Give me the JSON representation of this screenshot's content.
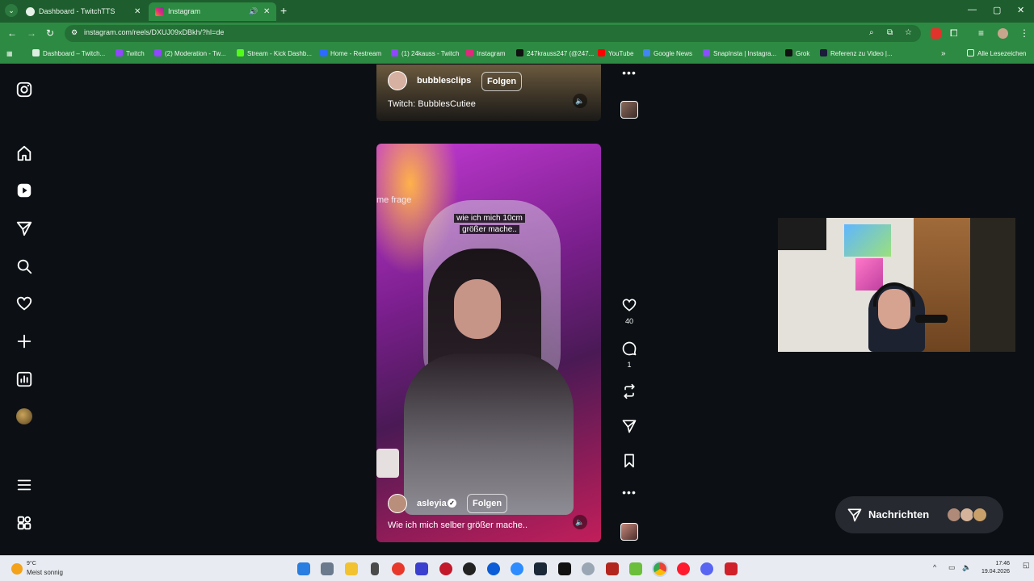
{
  "browser": {
    "tabs": [
      {
        "label": "Dashboard - TwitchTTS",
        "close": "✕"
      },
      {
        "label": "Instagram",
        "close": "✕",
        "audio_icon": "speaker-icon"
      }
    ],
    "new_tab": "+",
    "window_controls": [
      "—",
      "▢",
      "✕"
    ],
    "url": "instagram.com/reels/DXUJ09xDBkh/?hl=de",
    "bookmarks": [
      "Dashboard – Twitch...",
      "Twitch",
      "(2) Moderation - Tw...",
      "Stream - Kick Dashb...",
      "Home - Restream",
      "(1) 24kauss - Twitch",
      "Instagram",
      "247krauss247 (@247...",
      "YouTube",
      "Google News",
      "SnapInsta | Instagra...",
      "Grok",
      "Referenz zu Video |..."
    ],
    "bookmarks_more": "»",
    "all_bookmarks": "Alle Lesezeichen"
  },
  "reels": {
    "previous": {
      "username": "bubblesclips",
      "follow": "Folgen",
      "description": "Twitch: BubblesCutiee"
    },
    "current": {
      "overlay_text": "me frage",
      "caption_line1": "wie ich mich 10cm",
      "caption_line2": "größer mache..",
      "username": "asleyia",
      "verified": "✓",
      "follow": "Folgen",
      "description": "Wie ich mich selber größer mache.."
    }
  },
  "actions": {
    "likes": "40",
    "comments": "1",
    "more": "•••"
  },
  "messages": {
    "label": "Nachrichten"
  },
  "taskbar": {
    "weather_temp": "9°C",
    "weather_desc": "Meist sonnig",
    "time": "17:46",
    "date": "19.04.2026"
  },
  "colors": {
    "browser_green": "#2d8a42",
    "page_bg": "#0c1014",
    "taskbar_bg": "#e8ecf2"
  }
}
